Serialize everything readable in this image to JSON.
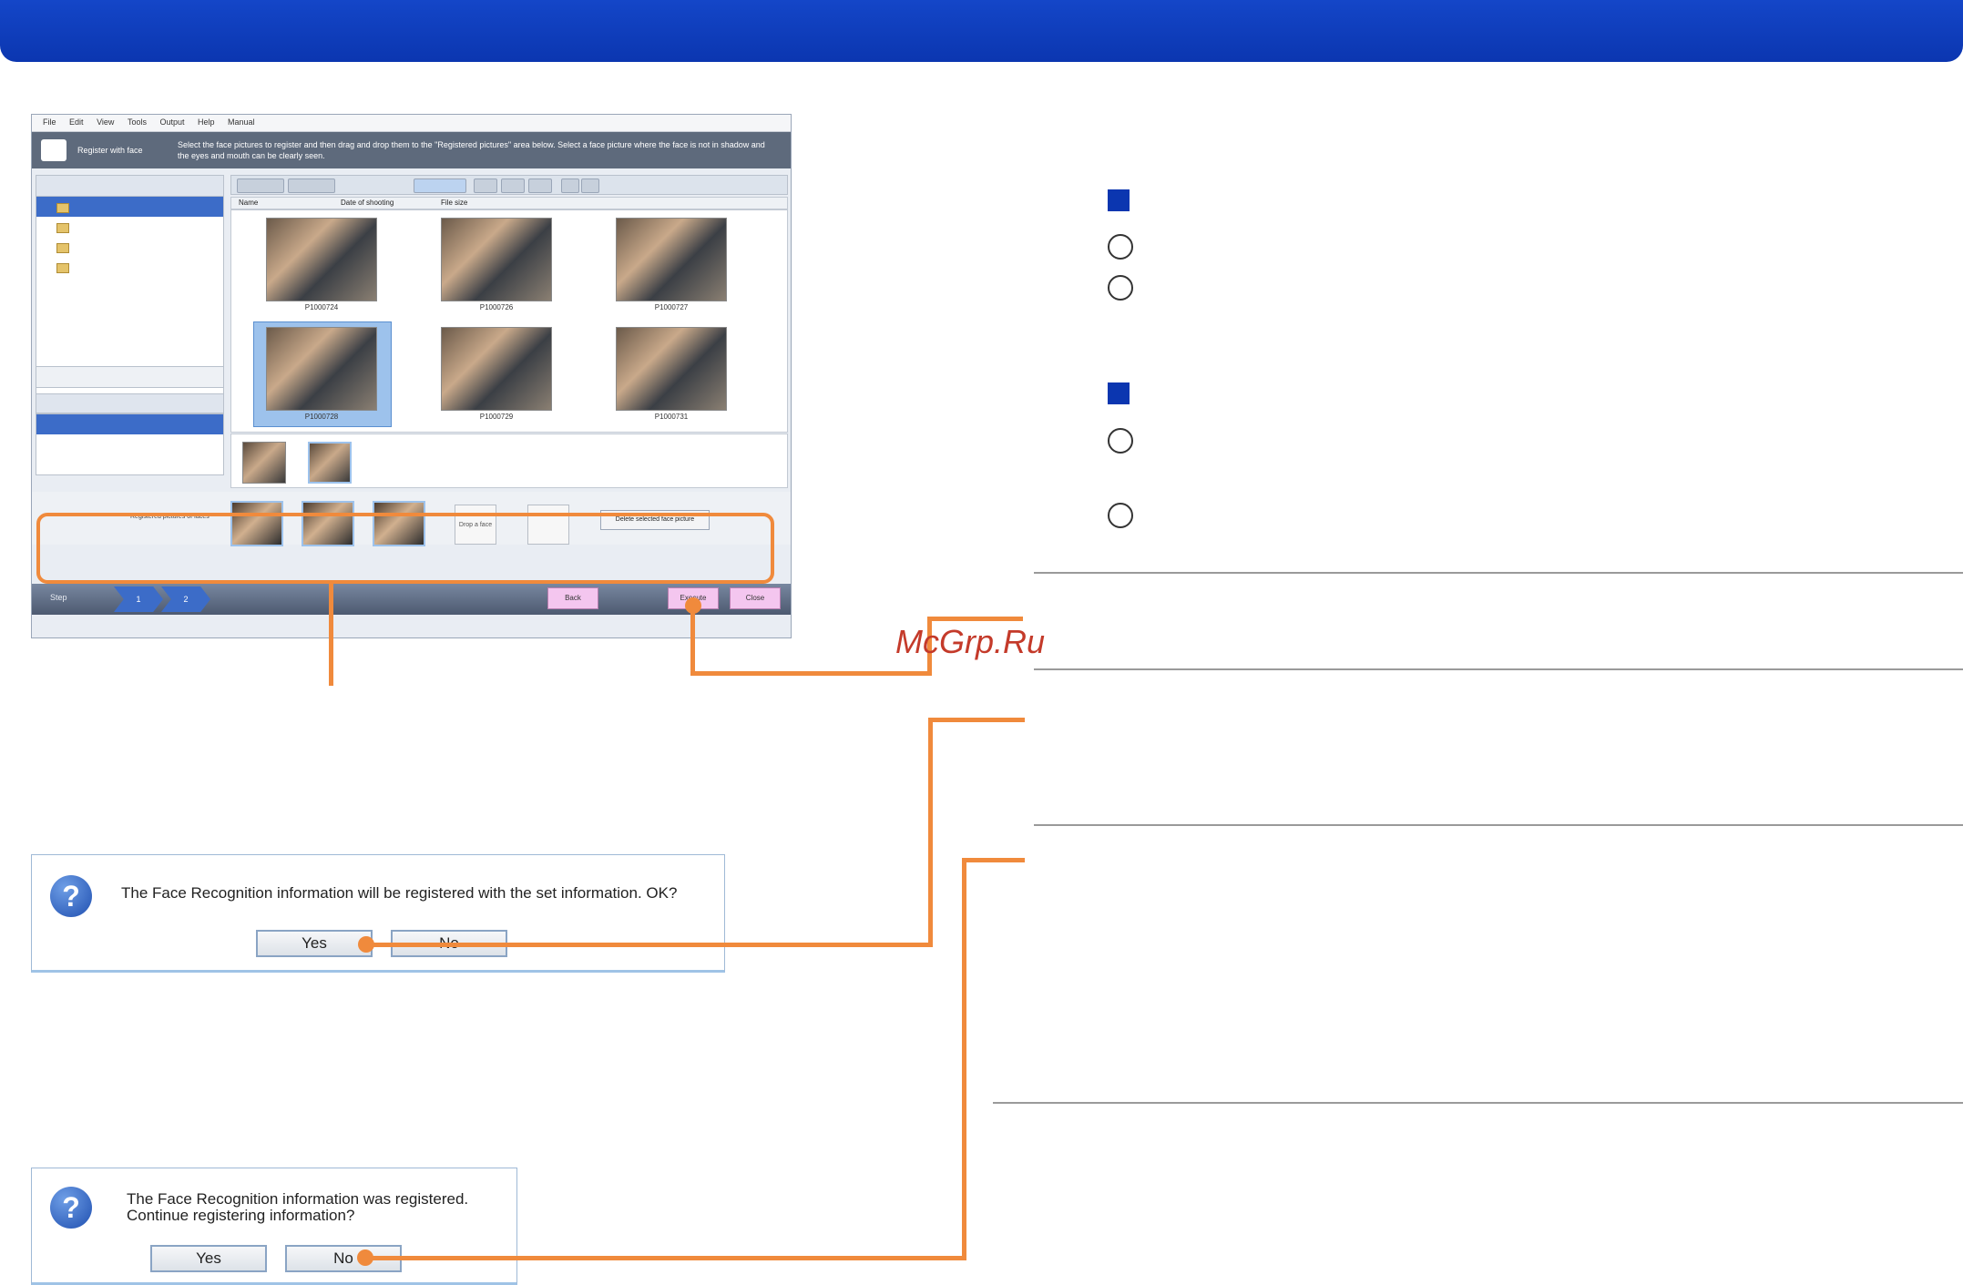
{
  "app_screenshot": {
    "menu": [
      "File",
      "Edit",
      "View",
      "Tools",
      "Output",
      "Help",
      "Manual"
    ],
    "header_title": "Register with face",
    "header_message": "Select the face pictures to register and then drag and drop them to the \"Registered pictures\" area below. Select a face picture where the face is not in shadow and the eyes and mouth can be clearly seen.",
    "columns": [
      "Name",
      "Date of shooting",
      "File size"
    ],
    "thumbnails": [
      "P1000724",
      "P1000726",
      "P1000727",
      "P1000728",
      "P1000729",
      "P1000731"
    ],
    "registered_label": "Registered pictures of faces",
    "drop_label": "Drop a face",
    "delete_button": "Delete selected face picture",
    "step_label": "Step",
    "steps": [
      "1",
      "2"
    ],
    "back_button": "Back",
    "execute_button": "Execute",
    "close_button": "Close"
  },
  "dialog1": {
    "message": "The Face Recognition information will be registered with the set information. OK?",
    "yes": "Yes",
    "no": "No"
  },
  "dialog2": {
    "message_line1": "The Face Recognition information was registered.",
    "message_line2": "Continue registering information?",
    "yes": "Yes",
    "no": "No"
  },
  "watermark": "McGrp.Ru",
  "colors": {
    "header_blue": "#0b36b0",
    "callout_orange": "#f08a3c"
  }
}
